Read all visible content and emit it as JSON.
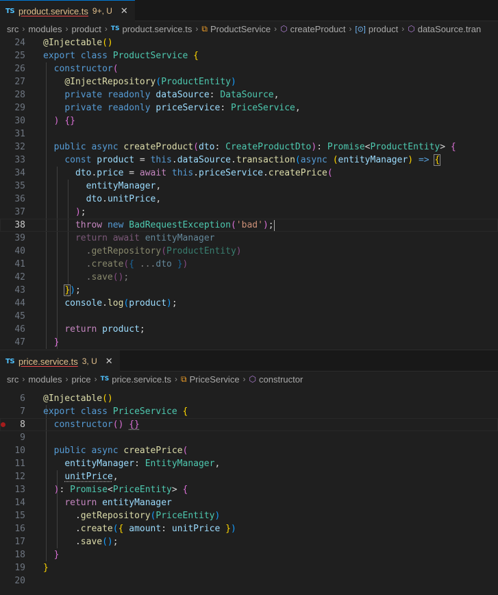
{
  "editor1": {
    "tab": {
      "icon": "TS",
      "name": "product.service.ts",
      "badge": "9+, U"
    },
    "breadcrumb": [
      "src",
      "modules",
      "product",
      "product.service.ts",
      "ProductService",
      "createProduct",
      "product",
      "dataSource.tran"
    ],
    "line_numbers": [
      "24",
      "25",
      "26",
      "27",
      "28",
      "29",
      "30",
      "31",
      "32",
      "33",
      "34",
      "35",
      "36",
      "37",
      "38",
      "39",
      "40",
      "41",
      "42",
      "43",
      "44",
      "45",
      "46",
      "47"
    ],
    "active_line": "38"
  },
  "editor2": {
    "tab": {
      "icon": "TS",
      "name": "price.service.ts",
      "badge": "3, U"
    },
    "breadcrumb": [
      "src",
      "modules",
      "price",
      "price.service.ts",
      "PriceService",
      "constructor"
    ],
    "line_numbers": [
      "6",
      "7",
      "8",
      "9",
      "10",
      "11",
      "12",
      "13",
      "14",
      "15",
      "16",
      "17",
      "18",
      "19",
      "20"
    ],
    "active_line": "8"
  },
  "colors": {
    "keyword": "#569cd6",
    "control": "#c586c0",
    "type": "#4ec9b0",
    "function": "#dcdcaa",
    "variable": "#9cdcfe",
    "string": "#ce9178",
    "breakpoint": "#a51c1c"
  },
  "icons": {
    "close": "close-icon",
    "class": "class-icon",
    "method": "method-icon",
    "variable": "variable-icon",
    "breakpoint": "breakpoint-icon"
  }
}
